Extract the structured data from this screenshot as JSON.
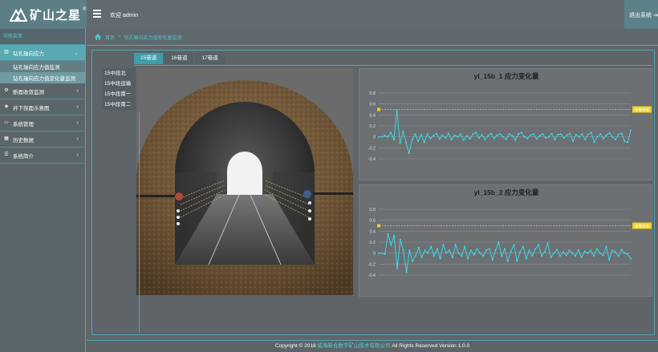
{
  "header": {
    "brand": "矿山之星",
    "reg_mark": "®",
    "welcome": "欢迎 admin",
    "logout": "退出系统"
  },
  "sidebar": {
    "title": "导航菜单",
    "items": [
      {
        "label": "钻孔轴向应力",
        "icon": "bar-chart-icon",
        "expanded": true,
        "subitems": [
          {
            "label": "钻孔轴向应力值监测"
          },
          {
            "label": "钻孔轴向应力值变化量监测"
          }
        ]
      },
      {
        "label": "断面收敛监测",
        "icon": "cogs-icon"
      },
      {
        "label": "井下剖面示意图",
        "icon": "cubes-icon"
      },
      {
        "label": "系统管理",
        "icon": "laptop-icon"
      },
      {
        "label": "历史数据",
        "icon": "table-icon"
      },
      {
        "label": "系统简介",
        "icon": "list-icon"
      }
    ]
  },
  "breadcrumb": {
    "home": "首页",
    "separator": ">",
    "current": "钻孔轴向应力值变化量监测"
  },
  "tabs": [
    {
      "label": "15巷道",
      "active": true
    },
    {
      "label": "16巷道",
      "active": false
    },
    {
      "label": "17巷道",
      "active": false
    }
  ],
  "roadways": [
    "15中段北",
    "15中段运输",
    "15中段南一",
    "15中段南二"
  ],
  "chart_data": [
    {
      "type": "line",
      "title": "yl_15b_1 应力变化量",
      "ylim": [
        -0.4,
        0.8
      ],
      "yticks": [
        "0.8",
        "0.6",
        "0.4",
        "0.2",
        "0",
        "-0.2",
        "-0.4"
      ],
      "threshold": {
        "value": 0.5,
        "label": "报警阈值"
      },
      "color": "#35e0f0",
      "threshold_color": "#f0d020",
      "values": [
        0.0,
        0.0,
        0.02,
        0.0,
        0.08,
        -0.05,
        0.48,
        -0.12,
        0.1,
        -0.1,
        -0.3,
        -0.05,
        0.05,
        -0.08,
        0.04,
        -0.1,
        0.05,
        -0.03,
        0.02,
        0.06,
        -0.04,
        0.03,
        -0.02,
        0.06,
        -0.05,
        0.03,
        0.0,
        0.05,
        -0.06,
        0.02,
        -0.04,
        0.05,
        0.08,
        -0.02,
        0.04,
        -0.05,
        0.02,
        0.06,
        -0.03,
        0.03,
        0.05,
        0.0,
        -0.05,
        0.05,
        0.02,
        -0.06,
        0.05,
        0.08,
        0.0,
        -0.03,
        0.03,
        0.05,
        -0.04,
        0.02,
        0.05,
        -0.02,
        0.0,
        0.06,
        -0.05,
        0.04,
        0.05,
        -0.02,
        0.03,
        0.06,
        -0.08,
        0.04,
        0.0,
        0.05,
        -0.05,
        0.04,
        0.08,
        -0.1,
        0.0,
        0.05,
        -0.03,
        0.03,
        0.07,
        0.0,
        -0.05,
        0.05,
        0.06,
        -0.08,
        -0.1,
        0.12
      ]
    },
    {
      "type": "line",
      "title": "yl_15b_2 应力变化量",
      "ylim": [
        -0.4,
        0.8
      ],
      "yticks": [
        "0.8",
        "0.6",
        "0.4",
        "0.2",
        "0",
        "-0.2",
        "-0.4"
      ],
      "threshold": {
        "value": 0.5,
        "label": "报警阈值"
      },
      "color": "#35e0f0",
      "threshold_color": "#f0d020",
      "values": [
        0.0,
        0.0,
        -0.02,
        0.35,
        0.15,
        0.32,
        -0.28,
        0.25,
        0.05,
        -0.35,
        0.05,
        -0.15,
        -0.05,
        0.1,
        -0.08,
        0.05,
        0.0,
        0.12,
        -0.05,
        0.08,
        -0.1,
        0.15,
        0.0,
        0.05,
        -0.08,
        0.15,
        0.0,
        -0.05,
        0.12,
        -0.1,
        0.05,
        -0.03,
        0.08,
        0.0,
        -0.05,
        0.05,
        0.08,
        -0.12,
        0.05,
        0.2,
        -0.05,
        0.08,
        -0.15,
        0.03,
        0.15,
        -0.15,
        0.02,
        0.12,
        -0.1,
        0.05,
        -0.05,
        0.08,
        0.15,
        -0.05,
        0.02,
        0.18,
        -0.08,
        0.0,
        0.06,
        -0.05,
        0.02,
        -0.04,
        0.05,
        0.0,
        -0.05,
        0.06,
        -0.08,
        0.03,
        0.0,
        0.05,
        -0.05,
        0.08,
        0.0,
        -0.04,
        0.12,
        -0.12,
        0.05,
        0.02,
        -0.05,
        0.06,
        0.0,
        -0.02,
        -0.1
      ]
    }
  ],
  "footer": {
    "copyright": "Copyright © 2018",
    "company": "威海新合数字矿山技术有限公司",
    "rights": "All Rights Reserved Version 1.0.0"
  }
}
